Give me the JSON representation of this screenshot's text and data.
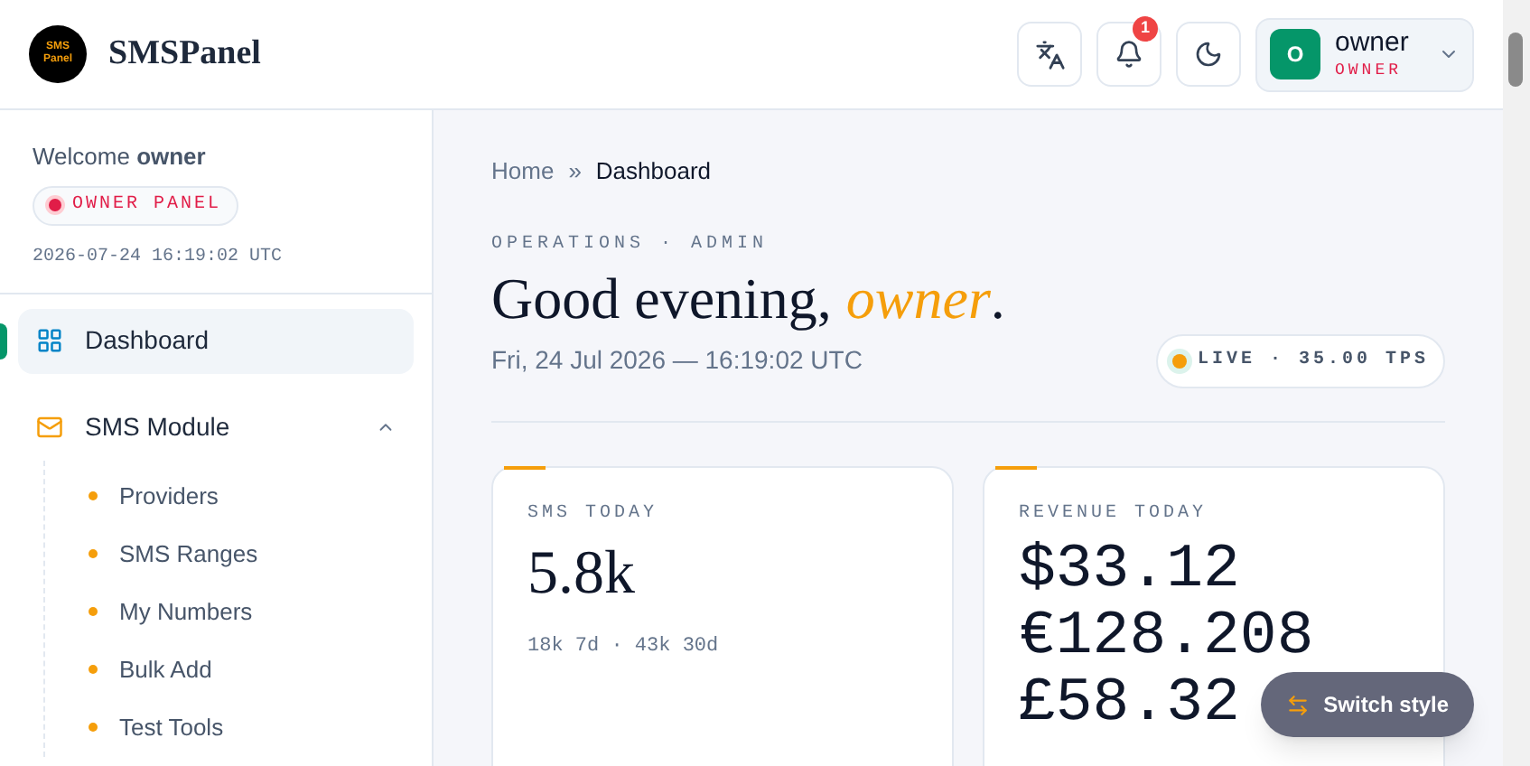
{
  "brand": {
    "name": "SMSPanel",
    "logo_text": "SMS Panel"
  },
  "header": {
    "notification_count": "1",
    "user": {
      "initial": "O",
      "name": "owner",
      "role": "OWNER"
    }
  },
  "sidebar": {
    "welcome": "Welcome",
    "username": "owner",
    "panel_badge": "OWNER PANEL",
    "timestamp": "2026-07-24 16:19:02 UTC",
    "items": [
      {
        "label": "Dashboard",
        "kind": "dashboard",
        "selected": true
      },
      {
        "label": "SMS Module",
        "kind": "module",
        "selected": false,
        "expanded": true,
        "children": [
          {
            "label": "Providers"
          },
          {
            "label": "SMS Ranges"
          },
          {
            "label": "My Numbers"
          },
          {
            "label": "Bulk Add"
          },
          {
            "label": "Test Tools"
          }
        ]
      }
    ]
  },
  "breadcrumb": [
    "Home",
    "»",
    "Dashboard"
  ],
  "eyebrow": "OPERATIONS · ADMIN",
  "greeting": {
    "text": "Good evening,",
    "name": "owner",
    "end": "."
  },
  "date": "Fri, 24 Jul 2026 — 16:19:02 UTC",
  "live_badge": "LIVE · 35.00 TPS",
  "cards": [
    {
      "title": "SMS TODAY",
      "kind": "serif",
      "values": [
        "5.8k"
      ],
      "footer": "18k 7d · 43k 30d"
    },
    {
      "title": "REVENUE TODAY",
      "kind": "mono",
      "values": [
        "$33.12",
        "€128.208",
        "£58.32"
      ]
    }
  ],
  "switch_button": "Switch style"
}
